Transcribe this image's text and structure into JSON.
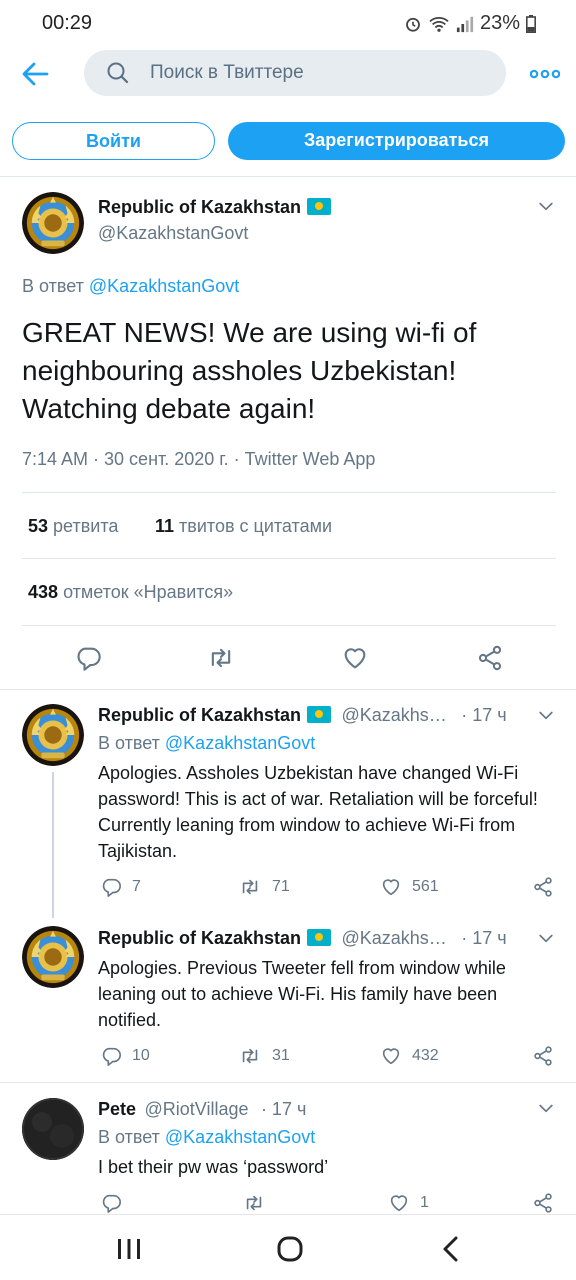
{
  "status_bar": {
    "time": "00:29",
    "battery": "23%"
  },
  "topbar": {
    "search_placeholder": "Поиск в Твиттере"
  },
  "auth": {
    "login_label": "Войти",
    "signup_label": "Зарегистрироваться"
  },
  "main_tweet": {
    "name": "Republic of Kazakhstan",
    "handle": "@KazakhstanGovt",
    "reply_prefix": "В ответ",
    "reply_to": "@KazakhstanGovt",
    "text": "GREAT NEWS! We are using wi-fi of neighbouring assholes Uzbekistan! Watching debate again!",
    "meta": "7:14 AM · 30 сент. 2020 г. · Twitter Web App",
    "retweets_count": "53",
    "retweets_label": "ретвита",
    "quotes_count": "11",
    "quotes_label": "твитов с цитатами",
    "likes_count": "438",
    "likes_label": "отметок «Нравится»"
  },
  "replies": [
    {
      "name": "Republic of Kazakhstan",
      "handle": "@Kazakhs…",
      "time": "· 17 ч",
      "reply_prefix": "В ответ",
      "reply_to": "@KazakhstanGovt",
      "text": "Apologies. Assholes Uzbekistan have changed Wi-Fi password! This is act of war. Retaliation will be forceful! Currently leaning from window to achieve Wi-Fi from Tajikistan.",
      "replies": "7",
      "retweets": "71",
      "likes": "561"
    },
    {
      "name": "Republic of Kazakhstan",
      "handle": "@Kazakhs…",
      "time": "· 17 ч",
      "text": "Apologies. Previous Tweeter fell from window while leaning out to achieve Wi-Fi. His family have been notified.",
      "replies": "10",
      "retweets": "31",
      "likes": "432"
    },
    {
      "name": "Pete",
      "handle": "@RiotVillage",
      "time": "· 17 ч",
      "reply_prefix": "В ответ",
      "reply_to": "@KazakhstanGovt",
      "text": "I bet their pw was ‘password’",
      "replies": "",
      "retweets": "",
      "likes": "1"
    }
  ],
  "colors": {
    "accent": "#1da1f2",
    "muted": "#657786",
    "divider": "#e1e8ed"
  },
  "icons": [
    "back-arrow-icon",
    "search-icon",
    "more-dots-icon",
    "chevron-down-icon",
    "reply-icon",
    "retweet-icon",
    "like-icon",
    "share-icon",
    "recents-icon",
    "home-icon",
    "nav-back-icon",
    "wifi-icon",
    "signal-icon",
    "battery-icon",
    "alarm-icon"
  ]
}
